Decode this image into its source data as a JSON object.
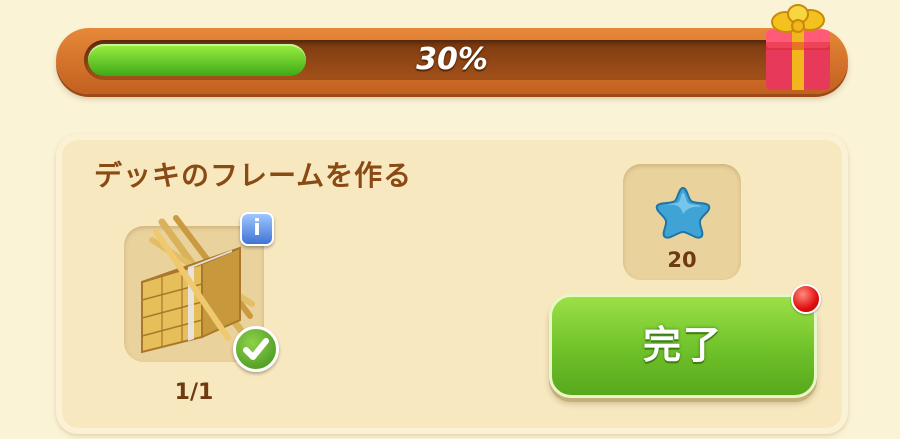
{
  "progress": {
    "label": "30%",
    "fraction": 0.3
  },
  "icons": {
    "gift": "gift-box-icon",
    "material": "wood-planks-icon",
    "info": "info-icon",
    "check": "checkmark-icon",
    "reward": "blue-star-icon",
    "notification": "red-dot-icon"
  },
  "task": {
    "title": "デッキのフレームを作る",
    "material_count": "1/1",
    "info_label": "i",
    "reward_count": "20",
    "complete_label": "完了"
  },
  "colors": {
    "progress_fill": "#3da918",
    "title_text": "#8a4a14",
    "button_green": "#6fc12a",
    "reward_star": "#3fa3d6"
  }
}
